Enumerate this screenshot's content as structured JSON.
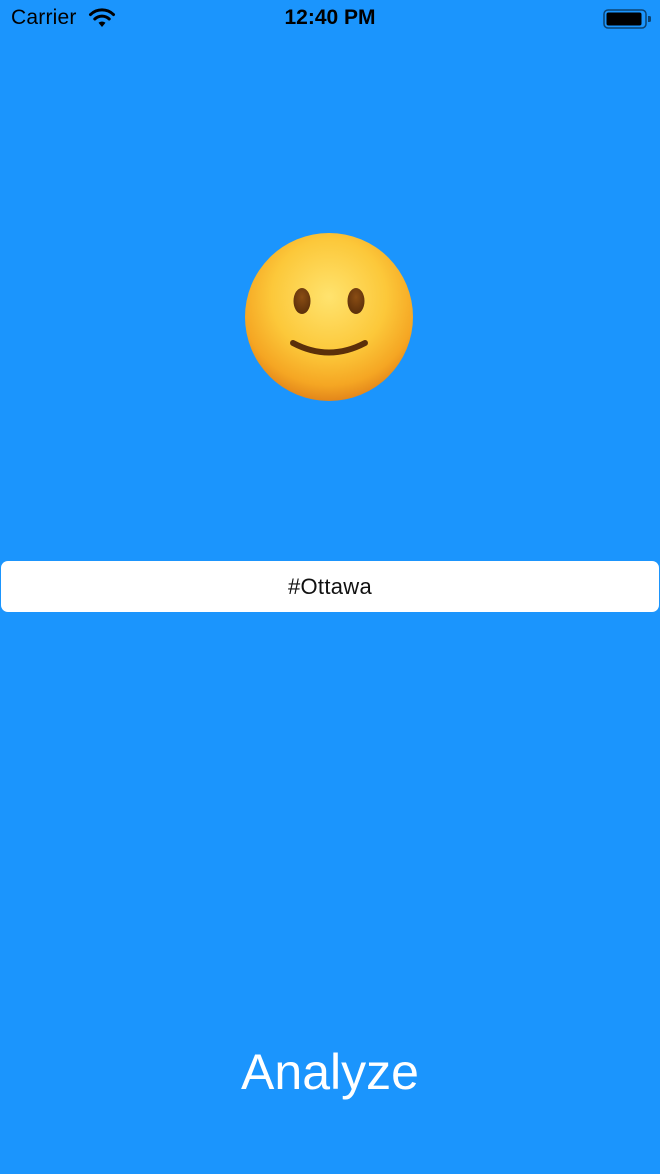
{
  "status_bar": {
    "carrier": "Carrier",
    "time": "12:40 PM",
    "icons": [
      "wifi-icon",
      "battery-icon"
    ]
  },
  "mood": {
    "icon": "slightly-smiling-face-icon"
  },
  "search": {
    "value": "#Ottawa"
  },
  "actions": {
    "analyze_label": "Analyze"
  },
  "colors": {
    "background": "#1b95fd",
    "field_background": "#ffffff",
    "button_text": "#ffffff"
  }
}
